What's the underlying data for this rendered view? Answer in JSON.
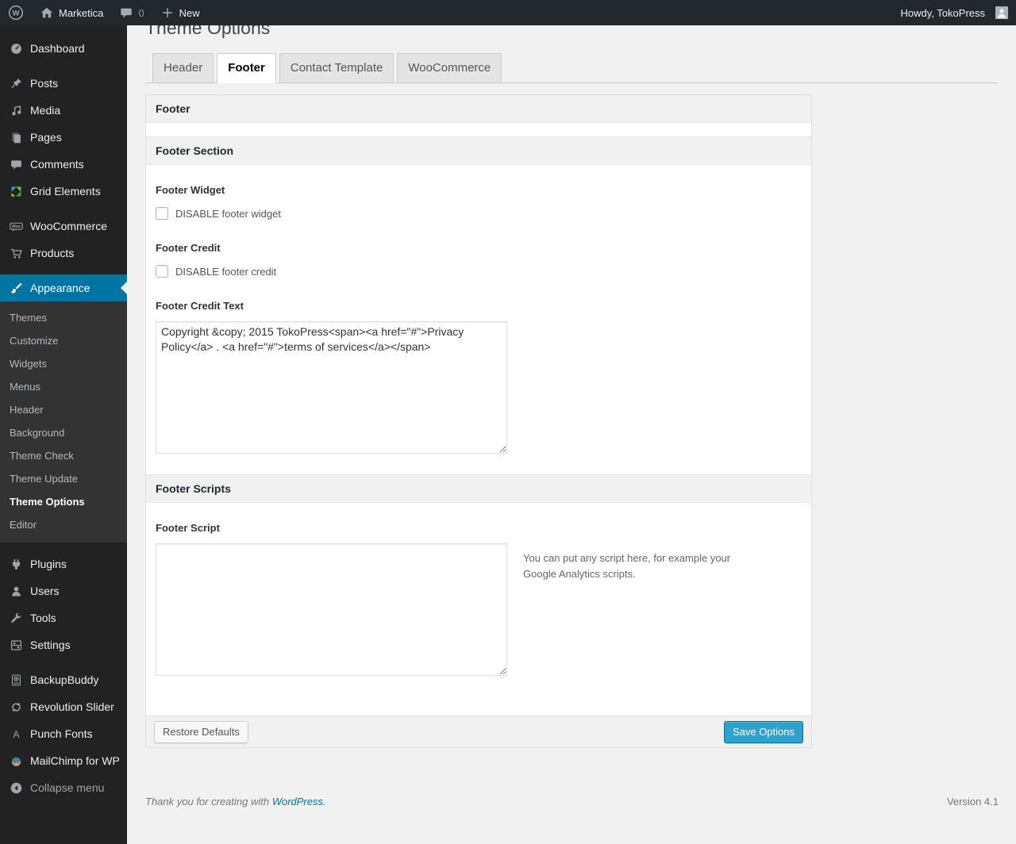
{
  "admin_bar": {
    "site_name": "Marketica",
    "comment_count": "0",
    "new_label": "New",
    "howdy": "Howdy, TokoPress"
  },
  "sidebar": {
    "items": [
      {
        "type": "item",
        "label": "Dashboard",
        "icon": "dashboard-icon",
        "name": "sidebar-item-dashboard"
      },
      {
        "type": "separator"
      },
      {
        "type": "item",
        "label": "Posts",
        "icon": "posts-icon",
        "name": "sidebar-item-posts"
      },
      {
        "type": "item",
        "label": "Media",
        "icon": "media-icon",
        "name": "sidebar-item-media"
      },
      {
        "type": "item",
        "label": "Pages",
        "icon": "pages-icon",
        "name": "sidebar-item-pages"
      },
      {
        "type": "item",
        "label": "Comments",
        "icon": "comments-icon",
        "name": "sidebar-item-comments"
      },
      {
        "type": "item",
        "label": "Grid Elements",
        "icon": "grid-elements-icon",
        "name": "sidebar-item-grid-elements"
      },
      {
        "type": "separator"
      },
      {
        "type": "item",
        "label": "WooCommerce",
        "icon": "woocommerce-icon",
        "name": "sidebar-item-woocommerce"
      },
      {
        "type": "item",
        "label": "Products",
        "icon": "products-icon",
        "name": "sidebar-item-products"
      },
      {
        "type": "separator"
      },
      {
        "type": "item",
        "label": "Appearance",
        "icon": "appearance-icon",
        "name": "sidebar-item-appearance",
        "active": true
      },
      {
        "type": "submenu",
        "label": "Themes",
        "name": "sidebar-subitem-themes"
      },
      {
        "type": "submenu",
        "label": "Customize",
        "name": "sidebar-subitem-customize"
      },
      {
        "type": "submenu",
        "label": "Widgets",
        "name": "sidebar-subitem-widgets"
      },
      {
        "type": "submenu",
        "label": "Menus",
        "name": "sidebar-subitem-menus"
      },
      {
        "type": "submenu",
        "label": "Header",
        "name": "sidebar-subitem-header"
      },
      {
        "type": "submenu",
        "label": "Background",
        "name": "sidebar-subitem-background"
      },
      {
        "type": "submenu",
        "label": "Theme Check",
        "name": "sidebar-subitem-theme-check"
      },
      {
        "type": "submenu",
        "label": "Theme Update",
        "name": "sidebar-subitem-theme-update"
      },
      {
        "type": "submenu",
        "label": "Theme Options",
        "name": "sidebar-subitem-theme-options",
        "current": true
      },
      {
        "type": "submenu",
        "label": "Editor",
        "name": "sidebar-subitem-editor"
      },
      {
        "type": "separator"
      },
      {
        "type": "item",
        "label": "Plugins",
        "icon": "plugins-icon",
        "name": "sidebar-item-plugins"
      },
      {
        "type": "item",
        "label": "Users",
        "icon": "users-icon",
        "name": "sidebar-item-users"
      },
      {
        "type": "item",
        "label": "Tools",
        "icon": "tools-icon",
        "name": "sidebar-item-tools"
      },
      {
        "type": "item",
        "label": "Settings",
        "icon": "settings-icon",
        "name": "sidebar-item-settings"
      },
      {
        "type": "separator"
      },
      {
        "type": "item",
        "label": "BackupBuddy",
        "icon": "backupbuddy-icon",
        "name": "sidebar-item-backupbuddy"
      },
      {
        "type": "item",
        "label": "Revolution Slider",
        "icon": "revolution-slider-icon",
        "name": "sidebar-item-revolution-slider"
      },
      {
        "type": "item",
        "label": "Punch Fonts",
        "icon": "punch-fonts-icon",
        "name": "sidebar-item-punch-fonts"
      },
      {
        "type": "item",
        "label": "MailChimp for WP",
        "icon": "mailchimp-icon",
        "name": "sidebar-item-mailchimp-for-wp"
      },
      {
        "type": "item",
        "label": "Collapse menu",
        "icon": "collapse-icon",
        "name": "sidebar-item-collapse-menu",
        "muted": true
      }
    ]
  },
  "page": {
    "title": "Theme Options",
    "tabs": [
      {
        "label": "Header",
        "name": "tab-header"
      },
      {
        "label": "Footer",
        "name": "tab-footer",
        "active": true
      },
      {
        "label": "Contact Template",
        "name": "tab-contact-template"
      },
      {
        "label": "WooCommerce",
        "name": "tab-woocommerce"
      }
    ]
  },
  "panel": {
    "title": "Footer",
    "sections": {
      "footer_section_title": "Footer Section",
      "footer_scripts_title": "Footer Scripts"
    },
    "fields": {
      "footer_widget_label": "Footer Widget",
      "footer_widget_checkbox_label": "DISABLE footer widget",
      "footer_credit_label": "Footer Credit",
      "footer_credit_checkbox_label": "DISABLE footer credit",
      "footer_credit_text_label": "Footer Credit Text",
      "footer_credit_text_value": "Copyright &copy; 2015 TokoPress<span><a href=\"#\">Privacy Policy</a> . <a href=\"#\">terms of services</a></span>",
      "footer_script_label": "Footer Script",
      "footer_script_value": "",
      "footer_script_help": "You can put any script here, for example your Google Analytics scripts."
    },
    "buttons": {
      "restore": "Restore Defaults",
      "save": "Save Options"
    }
  },
  "footer": {
    "thanks": "Thank you for creating with",
    "wordpress": "WordPress.",
    "version": "Version 4.1"
  },
  "colors": {
    "accent": "#0074a2",
    "primary_button": "#2ea2cc",
    "admin_dark": "#222",
    "content_bg": "#f1f1f1"
  }
}
